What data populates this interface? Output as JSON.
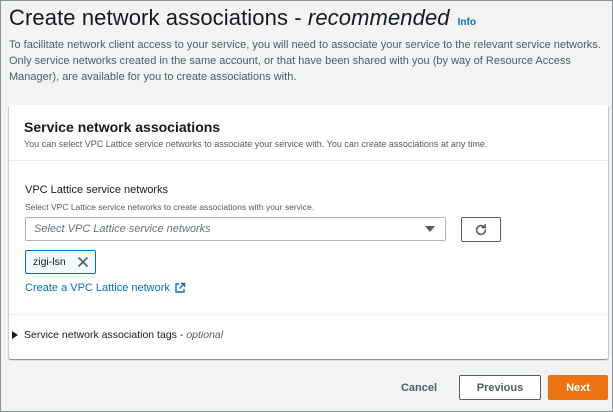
{
  "header": {
    "title": "Create network associations - ",
    "title_emphasis": "recommended",
    "info_label": "Info",
    "description": "To facilitate network client access to your service, you will need to associate your service to the relevant service networks. Only service networks created in the same account, or that have been shared with you (by way of Resource Access Manager), are available for you to create associations with."
  },
  "panel": {
    "title": "Service network associations",
    "description": "You can select VPC Lattice service networks to associate your service with. You can create associations at any time.",
    "field": {
      "label": "VPC Lattice service networks",
      "description": "Select VPC Lattice service networks to create associations with your service.",
      "placeholder": "Select VPC Lattice service networks",
      "selected_tokens": [
        "zigi-lsn"
      ]
    },
    "create_link": "Create a VPC Lattice network",
    "expander": {
      "label": "Service network association tags - ",
      "optional": "optional"
    }
  },
  "footer": {
    "cancel_label": "Cancel",
    "previous_label": "Previous",
    "next_label": "Next"
  },
  "colors": {
    "link": "#0073bb",
    "primary_button": "#ec7211",
    "token_border": "#0073bb",
    "background": "#f2f3f3"
  },
  "icons": [
    "caret-down-icon",
    "refresh-icon",
    "close-icon",
    "external-link-icon",
    "caret-right-icon"
  ]
}
